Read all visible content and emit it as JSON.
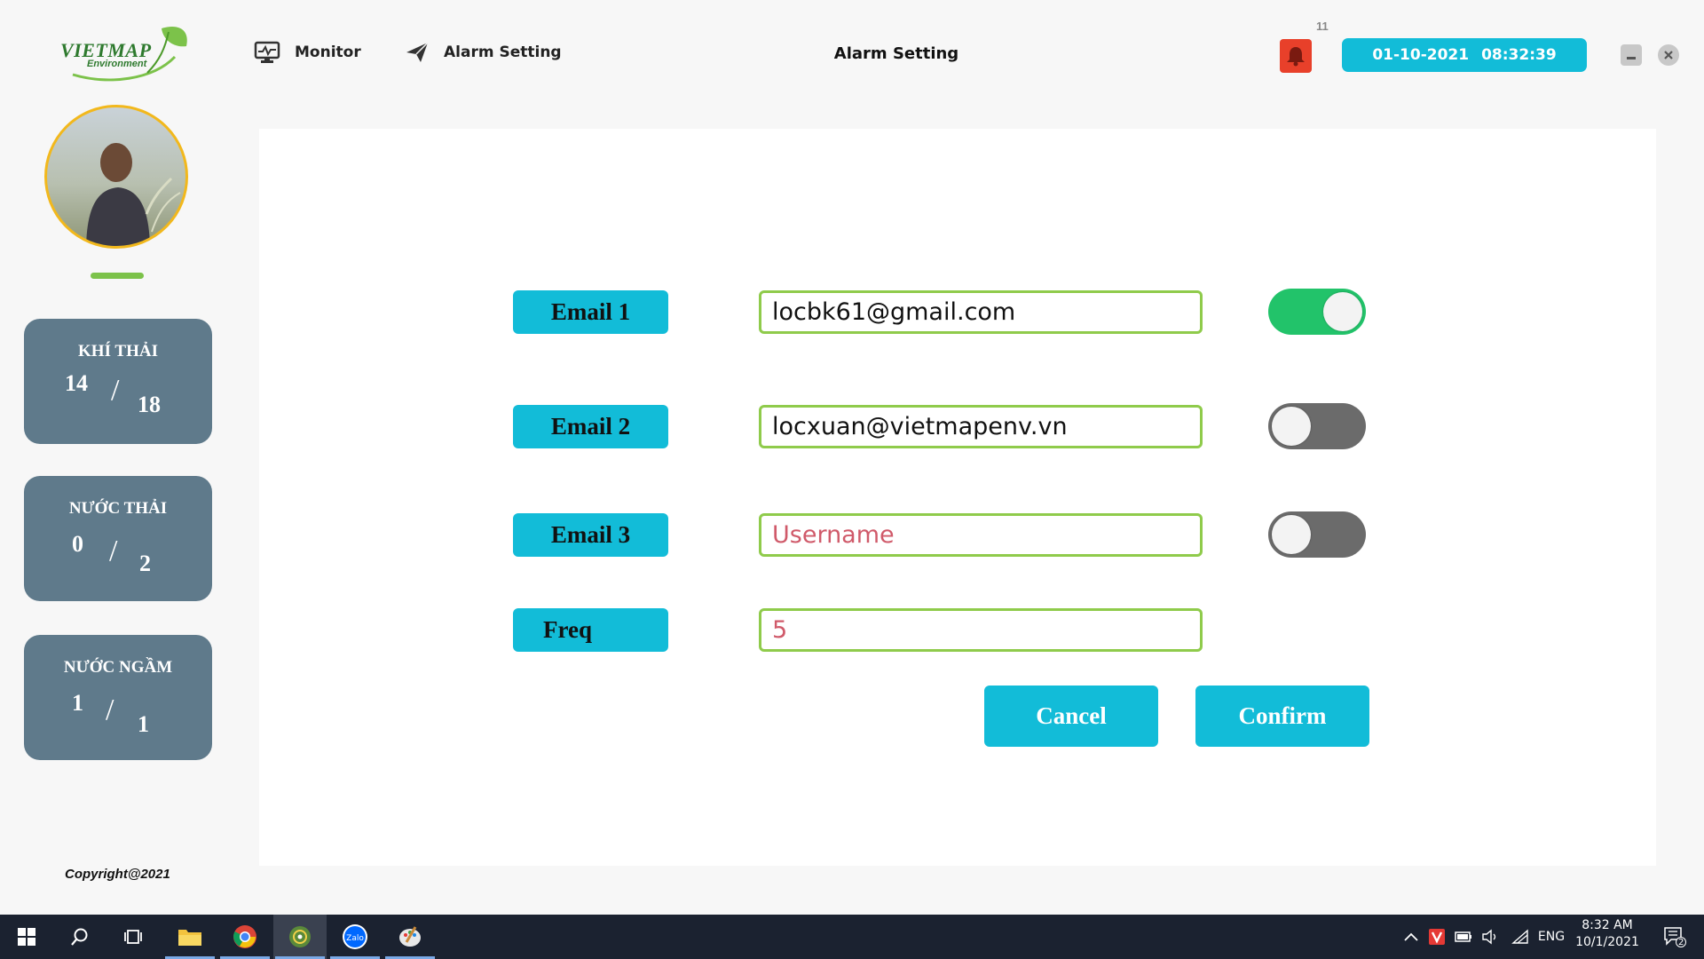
{
  "header": {
    "logo_text": "VIETMAP",
    "logo_sub": "Environment",
    "nav": [
      {
        "label": "Monitor",
        "icon": "monitor-icon"
      },
      {
        "label": "Alarm Setting",
        "icon": "paper-plane-icon"
      }
    ],
    "page_title": "Alarm Setting",
    "alarm_count": "11",
    "clock_date": "01-10-2021",
    "clock_time": "08:32:39"
  },
  "sidebar": {
    "cards": [
      {
        "title": "KHÍ THẢI",
        "current": "14",
        "total": "18"
      },
      {
        "title": "NƯỚC THẢI",
        "current": "0",
        "total": "2"
      },
      {
        "title": "NƯỚC NGẦM",
        "current": "1",
        "total": "1"
      }
    ],
    "copyright": "Copyright@2021"
  },
  "form": {
    "rows": [
      {
        "label": "Email 1",
        "value": "locbk61@gmail.com",
        "placeholder": "",
        "enabled": true
      },
      {
        "label": "Email 2",
        "value": "locxuan@vietmapenv.vn",
        "placeholder": "",
        "enabled": false
      },
      {
        "label": "Email 3",
        "value": "",
        "placeholder": "Username",
        "enabled": false
      }
    ],
    "freq": {
      "label": "Freq",
      "value": "5"
    },
    "cancel_label": "Cancel",
    "confirm_label": "Confirm"
  },
  "taskbar": {
    "language": "ENG",
    "time": "8:32 AM",
    "date": "10/1/2021",
    "notification_count": "2"
  },
  "colors": {
    "accent": "#12bcd8",
    "card": "#5f7a8b",
    "input_border": "#8fcb4b",
    "toggle_on": "#22c36a",
    "toggle_off": "#6b6b6b",
    "bell": "#e8402a"
  }
}
